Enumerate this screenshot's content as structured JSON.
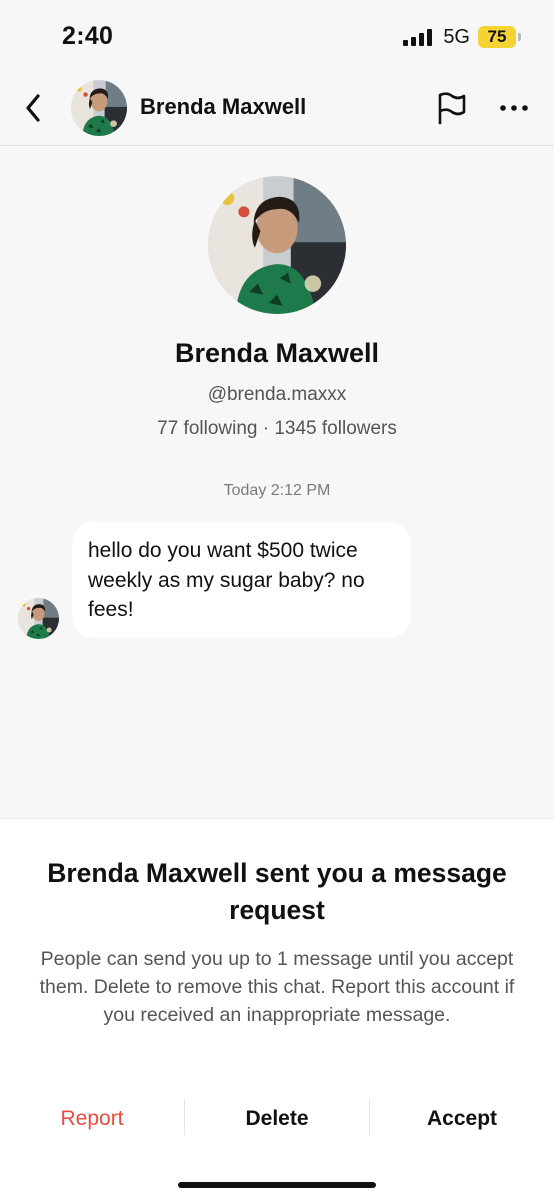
{
  "status_bar": {
    "time": "2:40",
    "network": "5G",
    "battery": "75"
  },
  "header": {
    "name": "Brenda Maxwell",
    "back_icon": "chevron-left-icon",
    "flag_icon": "flag-icon",
    "more_icon": "more-horizontal-icon"
  },
  "profile": {
    "name": "Brenda Maxwell",
    "handle": "@brenda.maxxx",
    "stats": "77 following · 1345 followers"
  },
  "conversation": {
    "timestamp": "Today 2:12 PM",
    "messages": [
      {
        "text": "hello do you want $500 twice weekly as my sugar baby? no fees!"
      }
    ]
  },
  "request": {
    "title": "Brenda Maxwell sent you a message request",
    "body": "People can send you up to 1 message until you accept them. Delete to remove this chat. Report this account if you received an inappropriate message.",
    "report_label": "Report",
    "delete_label": "Delete",
    "accept_label": "Accept"
  },
  "colors": {
    "report": "#ea4d3d",
    "battery": "#f5d335",
    "background": "#f7f7f7"
  }
}
